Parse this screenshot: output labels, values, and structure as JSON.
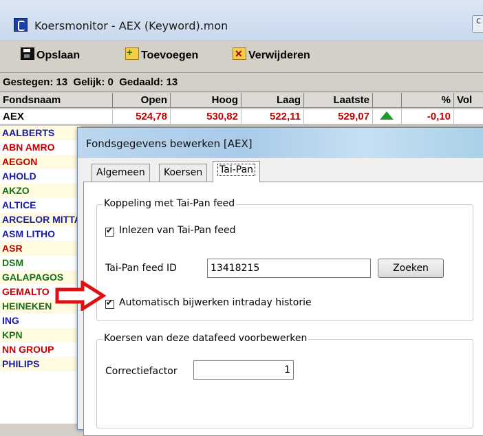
{
  "main": {
    "title": "Koersmonitor - AEX (Keyword).mon",
    "close_btn_text": "c"
  },
  "toolbar": {
    "save_label": "Opslaan",
    "add_label": "Toevoegen",
    "delete_label": "Verwijderen"
  },
  "stats": {
    "text": "Gestegen: 13  Gelijk: 0  Gedaald: 13"
  },
  "table": {
    "headers": [
      "Fondsnaam",
      "Open",
      "Hoog",
      "Laag",
      "Laatste",
      "",
      "%",
      "Vol"
    ],
    "aex_row": {
      "name": "AEX",
      "open": "524,78",
      "hoog": "530,82",
      "laag": "522,11",
      "laatste": "529,07",
      "trend_icon": "up-arrow",
      "pct": "-0,10"
    },
    "funds": [
      {
        "name": "AALBERTS",
        "color": "#1a1aa8"
      },
      {
        "name": "ABN AMRO",
        "color": "#c00000"
      },
      {
        "name": "AEGON",
        "color": "#c00000"
      },
      {
        "name": "AHOLD",
        "color": "#1a1aa8"
      },
      {
        "name": "AKZO",
        "color": "#167016"
      },
      {
        "name": "ALTICE",
        "color": "#1a1aa8"
      },
      {
        "name": "ARCELOR MITTAL",
        "color": "#1a1aa8"
      },
      {
        "name": "ASM LITHO",
        "color": "#1a1aa8"
      },
      {
        "name": "ASR",
        "color": "#c00000"
      },
      {
        "name": "DSM",
        "color": "#167016"
      },
      {
        "name": "GALAPAGOS",
        "color": "#167016"
      },
      {
        "name": "GEMALTO",
        "color": "#c00000"
      },
      {
        "name": "HEINEKEN",
        "color": "#167016"
      },
      {
        "name": "ING",
        "color": "#1a1aa8"
      },
      {
        "name": "KPN",
        "color": "#167016"
      },
      {
        "name": "NN GROUP",
        "color": "#c00000"
      },
      {
        "name": "PHILIPS",
        "color": "#1a1aa8"
      }
    ]
  },
  "dialog": {
    "title": "Fondsgegevens bewerken [AEX]",
    "tabs": [
      "Algemeen",
      "Koersen",
      "Tai-Pan"
    ],
    "active_tab": "Tai-Pan",
    "group1": {
      "label": "Koppeling met Tai-Pan feed",
      "read_feed_label": "Inlezen van Tai-Pan feed",
      "read_feed_checked": true,
      "feed_id_label": "Tai-Pan feed ID",
      "feed_id_value": "13418215",
      "search_button": "Zoeken",
      "auto_update_label": "Automatisch bijwerken intraday historie",
      "auto_update_checked": true
    },
    "group2": {
      "label": "Koersen van deze datafeed voorbewerken",
      "factor_label": "Correctiefactor",
      "factor_value": "1"
    }
  },
  "colors": {
    "up": "#1e9b2a",
    "down": "#c00000",
    "annotation_arrow": "#e01010"
  }
}
